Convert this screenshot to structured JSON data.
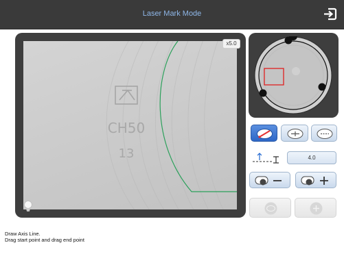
{
  "header": {
    "title": "Laser Mark Mode"
  },
  "camera": {
    "zoom_label": "x5.0",
    "engraving_line1": "CH50",
    "engraving_line2": "13"
  },
  "controls": {
    "gap_value": "4.0"
  },
  "status": {
    "line1": "Draw Axis Line.",
    "line2": "Drag start point and drag end point"
  },
  "colors": {
    "header_bg": "#3a3a3a",
    "title": "#8fb7e8",
    "active_tool": "#2e67c7",
    "axis_line": "#2aa05a",
    "selection_box": "#e02020"
  },
  "icons": {
    "exit": "exit-icon",
    "lightbulb": "lightbulb-icon",
    "draw_axis": "draw-axis-line-icon",
    "align_in": "lens-align-in-icon",
    "align_out": "lens-align-out-icon",
    "gap": "gap-adjust-icon",
    "brightness_minus": "brightness-minus-icon",
    "brightness_plus": "brightness-plus-icon"
  }
}
